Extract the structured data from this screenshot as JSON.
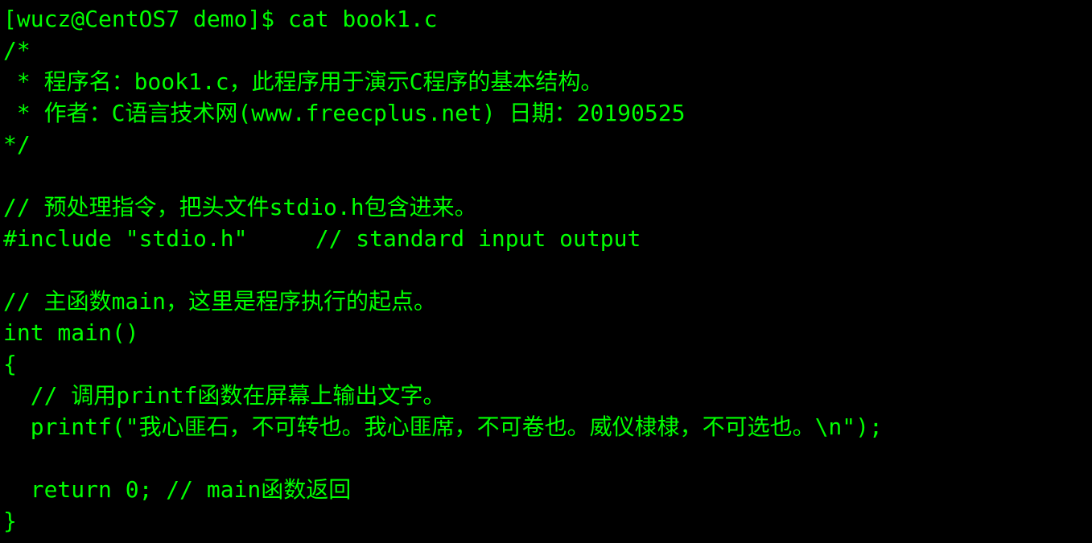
{
  "terminal": {
    "foreground_color": "#00ff00",
    "background_color": "#000000",
    "lines": [
      "[wucz@CentOS7 demo]$ cat book1.c",
      "/*",
      " * 程序名：book1.c，此程序用于演示C程序的基本结构。",
      " * 作者：C语言技术网(www.freecplus.net) 日期：20190525",
      "*/",
      "",
      "// 预处理指令，把头文件stdio.h包含进来。",
      "#include \"stdio.h\"     // standard input output",
      "",
      "// 主函数main，这里是程序执行的起点。",
      "int main()",
      "{",
      "  // 调用printf函数在屏幕上输出文字。",
      "  printf(\"我心匪石，不可转也。我心匪席，不可卷也。威仪棣棣，不可选也。\\n\");",
      "",
      "  return 0; // main函数返回",
      "}"
    ]
  }
}
